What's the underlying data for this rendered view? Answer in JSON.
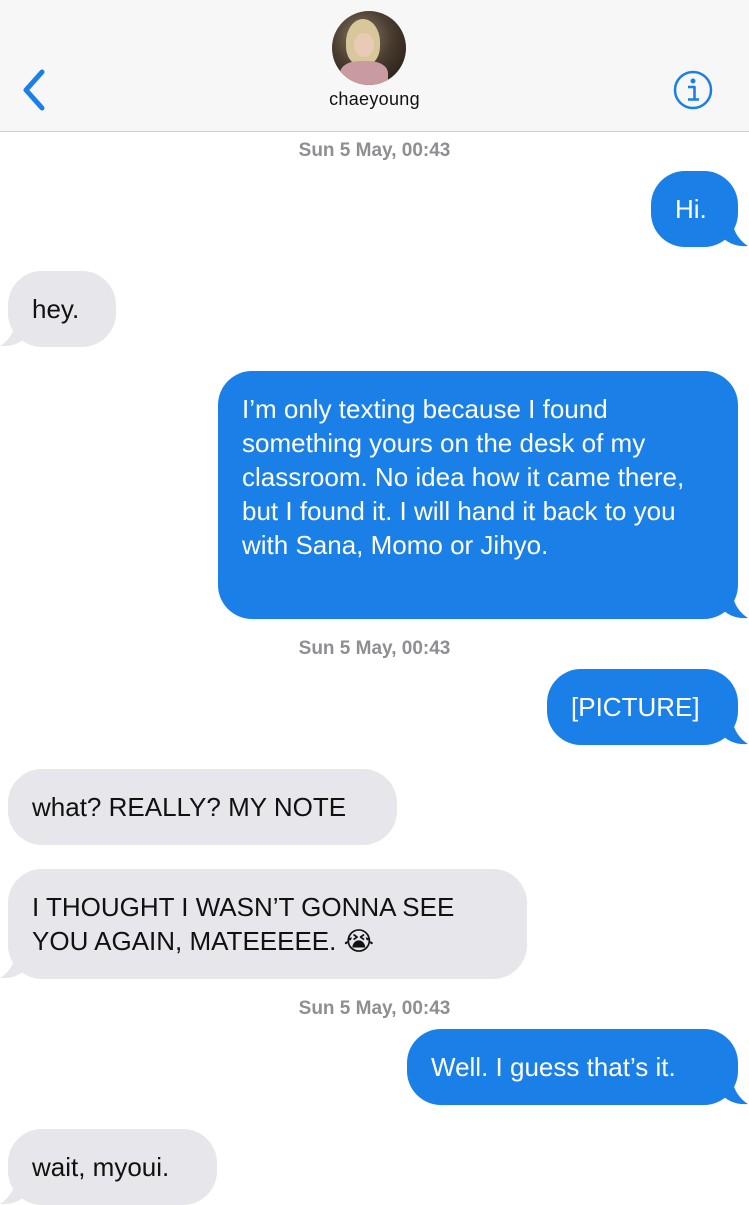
{
  "header": {
    "contact_name": "chaeyoung",
    "back_icon": "chevron-left-icon",
    "info_icon": "info-circle-icon",
    "avatar_alt": "contact photo"
  },
  "colors": {
    "outgoing": "#1b7fe8",
    "incoming": "#e6e6eb",
    "accent": "#1b7fe8",
    "timestamp": "#8e8e93"
  },
  "timestamps": [
    "Sun 5 May, 00:43",
    "Sun 5 May, 00:43",
    "Sun 5 May, 00:43"
  ],
  "messages": [
    {
      "direction": "outgoing",
      "text": "Hi."
    },
    {
      "direction": "incoming",
      "text": "hey."
    },
    {
      "direction": "outgoing",
      "text": "I’m only texting because I found something yours on the desk of my classroom. No idea how it came there, but I found it. I will hand it back to you with Sana, Momo or Jihyo."
    },
    {
      "direction": "outgoing",
      "text": "[PICTURE]"
    },
    {
      "direction": "incoming",
      "text": "what? REALLY? MY NOTE"
    },
    {
      "direction": "incoming",
      "text": "I THOUGHT I WASN’T GONNA SEE YOU AGAIN, MATEEEEE. 😭"
    },
    {
      "direction": "outgoing",
      "text": "Well. I guess that’s it."
    },
    {
      "direction": "incoming",
      "text": "wait, myoui."
    }
  ]
}
